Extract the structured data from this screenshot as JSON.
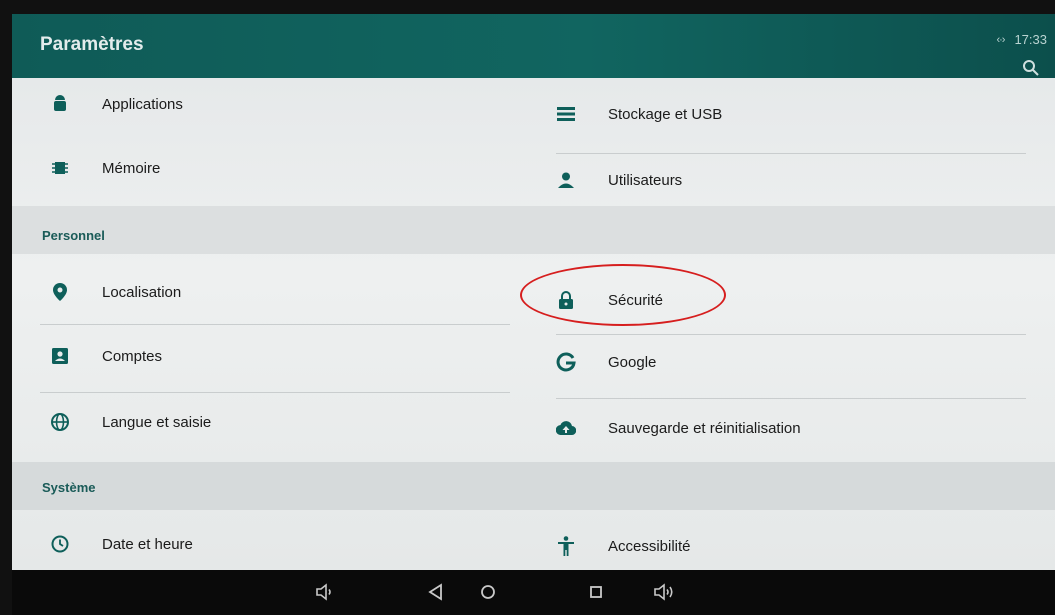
{
  "app": {
    "title": "Paramètres"
  },
  "status": {
    "time": "17:33",
    "sync_glyph": "‹·›"
  },
  "top_items_left": [
    {
      "label": "Applications",
      "icon": "android-icon"
    },
    {
      "label": "Mémoire",
      "icon": "memory-icon"
    }
  ],
  "top_items_right": [
    {
      "label": "Stockage et USB",
      "icon": "storage-icon"
    },
    {
      "label": "Utilisateurs",
      "icon": "person-icon"
    }
  ],
  "sections": {
    "personnel": {
      "label": "Personnel",
      "left": [
        {
          "label": "Localisation",
          "icon": "location-icon"
        },
        {
          "label": "Comptes",
          "icon": "account-icon"
        },
        {
          "label": "Langue et saisie",
          "icon": "globe-icon"
        }
      ],
      "right": [
        {
          "label": "Sécurité",
          "icon": "lock-icon"
        },
        {
          "label": "Google",
          "icon": "google-icon"
        },
        {
          "label": "Sauvegarde et réinitialisation",
          "icon": "cloud-upload-icon"
        }
      ]
    },
    "systeme": {
      "label": "Système",
      "left": [
        {
          "label": "Date et heure",
          "icon": "clock-icon"
        }
      ],
      "right": [
        {
          "label": "Accessibilité",
          "icon": "accessibility-icon"
        }
      ]
    }
  },
  "colors": {
    "accent": "#0e5f5a",
    "header": "#116560",
    "highlight": "#d61e1e"
  },
  "navbar": [
    "volume-down-icon",
    "back-icon",
    "home-icon",
    "recents-icon",
    "volume-up-icon"
  ]
}
